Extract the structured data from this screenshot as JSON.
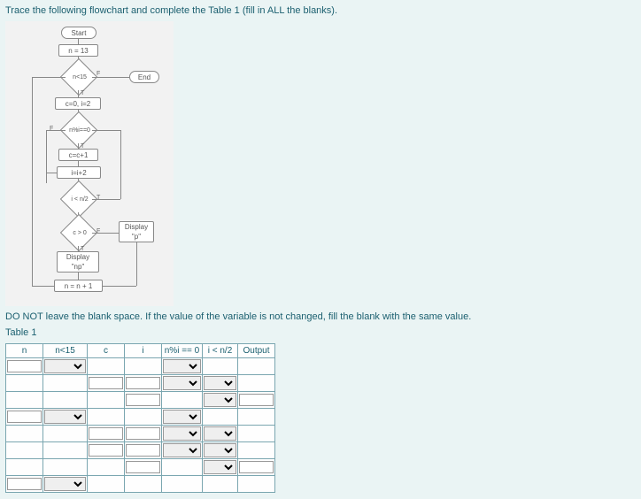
{
  "instruction": "Trace the following flowchart and complete the Table 1 (fill in ALL the blanks).",
  "note": "DO NOT leave the blank space. If the value of the variable is not changed, fill the blank with the same value.",
  "table_title": "Table 1",
  "flow": {
    "start": "Start",
    "n_assign": "n = 13",
    "n_lt_15": "n<15",
    "end": "End",
    "init": "c=0, i=2",
    "mod": "n%i==0",
    "c_inc": "c=c+1",
    "i_inc": "i=i+2",
    "i_lt_half": "i < n/2",
    "c_gt_0": "c > 0",
    "disp_np": "Display\n\"np\"",
    "disp_p": "Display\n\"p\"",
    "n_inc": "n = n + 1",
    "T": "T",
    "F": "F"
  },
  "headers": [
    "n",
    "n<15",
    "c",
    "i",
    "n%i == 0",
    "i < n/2",
    "Output"
  ],
  "rows": [
    {
      "cells": [
        "text",
        "select",
        "none",
        "none",
        "select",
        "none",
        "none"
      ]
    },
    {
      "cells": [
        "none",
        "none",
        "text",
        "text",
        "select",
        "select",
        "none"
      ]
    },
    {
      "cells": [
        "none",
        "none",
        "none",
        "text",
        "none",
        "select",
        "text"
      ]
    },
    {
      "cells": [
        "text",
        "select",
        "none",
        "none",
        "select",
        "none",
        "none"
      ]
    },
    {
      "cells": [
        "none",
        "none",
        "text",
        "text",
        "select",
        "select",
        "none"
      ]
    },
    {
      "cells": [
        "none",
        "none",
        "text",
        "text",
        "select",
        "select",
        "none"
      ]
    },
    {
      "cells": [
        "none",
        "none",
        "none",
        "text",
        "none",
        "select",
        "text"
      ]
    },
    {
      "cells": [
        "text",
        "select",
        "none",
        "none",
        "none",
        "none",
        "none"
      ]
    }
  ]
}
